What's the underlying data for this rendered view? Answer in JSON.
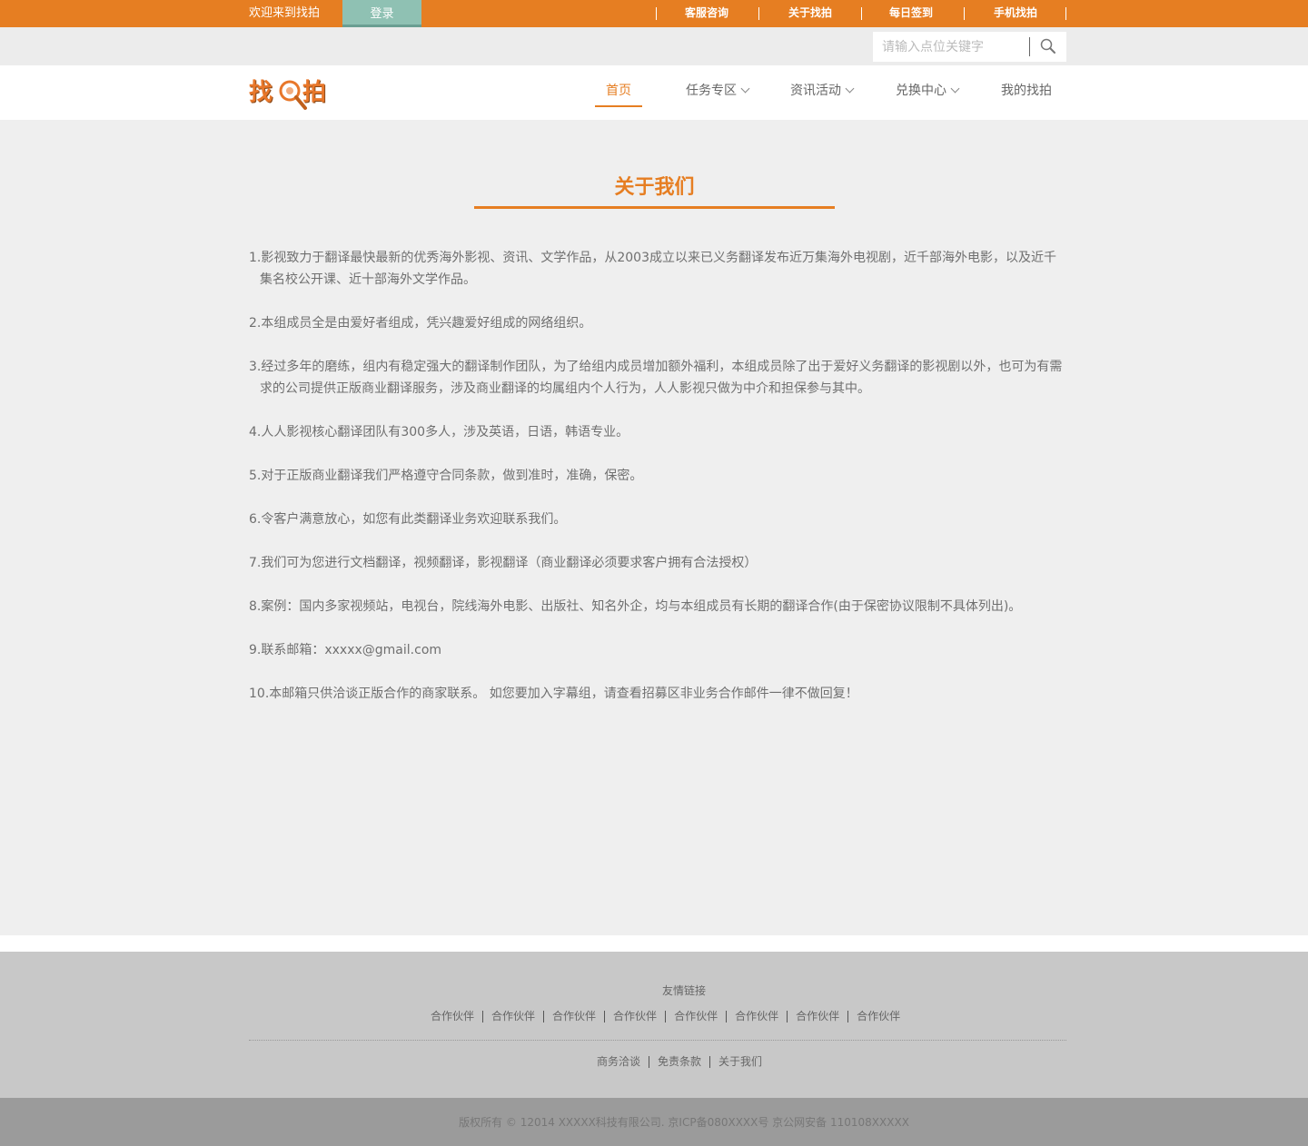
{
  "topbar": {
    "welcome": "欢迎来到找拍",
    "login": "登录",
    "links": [
      "客服咨询",
      "关于找拍",
      "每日签到",
      "手机找拍"
    ]
  },
  "search": {
    "placeholder": "请输入点位关键字",
    "button_icon": "search-icon"
  },
  "logo": {
    "text": "找拍",
    "icon": "magnifier-icon"
  },
  "nav": {
    "items": [
      {
        "label": "首页",
        "active": true,
        "dropdown": false
      },
      {
        "label": "任务专区",
        "active": false,
        "dropdown": true
      },
      {
        "label": "资讯活动",
        "active": false,
        "dropdown": true
      },
      {
        "label": "兑换中心",
        "active": false,
        "dropdown": true
      },
      {
        "label": "我的找拍",
        "active": false,
        "dropdown": false
      }
    ]
  },
  "main": {
    "title": "关于我们",
    "paragraphs": [
      "1.影视致力于翻译最快最新的优秀海外影视、资讯、文学作品，从2003成立以来已义务翻译发布近万集海外电视剧，近千部海外电影，以及近千集名校公开课、近十部海外文学作品。",
      "2.本组成员全是由爱好者组成，凭兴趣爱好组成的网络组织。",
      "3.经过多年的磨练，组内有稳定强大的翻译制作团队，为了给组内成员增加额外福利，本组成员除了出于爱好义务翻译的影视剧以外，也可为有需求的公司提供正版商业翻译服务，涉及商业翻译的均属组内个人行为，人人影视只做为中介和担保参与其中。",
      "4.人人影视核心翻译团队有300多人，涉及英语，日语，韩语专业。",
      "5.对于正版商业翻译我们严格遵守合同条款，做到准时，准确，保密。",
      "6.令客户满意放心，如您有此类翻译业务欢迎联系我们。",
      "7.我们可为您进行文档翻译，视频翻译，影视翻译（商业翻译必须要求客户拥有合法授权）",
      "8.案例：国内多家视频站，电视台，院线海外电影、出版社、知名外企，均与本组成员有长期的翻译合作(由于保密协议限制不具体列出)。",
      "9.联系邮箱：xxxxx@gmail.com",
      "10.本邮箱只供洽谈正版合作的商家联系。 如您要加入字幕组，请查看招募区非业务合作邮件一律不做回复！"
    ]
  },
  "footer": {
    "friend_title": "友情链接",
    "friend_links": [
      "合作伙伴",
      "合作伙伴",
      "合作伙伴",
      "合作伙伴",
      "合作伙伴",
      "合作伙伴",
      "合作伙伴",
      "合作伙伴"
    ],
    "bottom_links": [
      "商务洽谈",
      "免责条款",
      "关于我们"
    ],
    "copyright": "版权所有 © 12014 XXXXX科技有限公司. 京ICP备080XXXX号 京公网安备 110108XXXXX"
  },
  "colors": {
    "accent": "#e67e22",
    "login_bg": "#8fc1b3"
  }
}
